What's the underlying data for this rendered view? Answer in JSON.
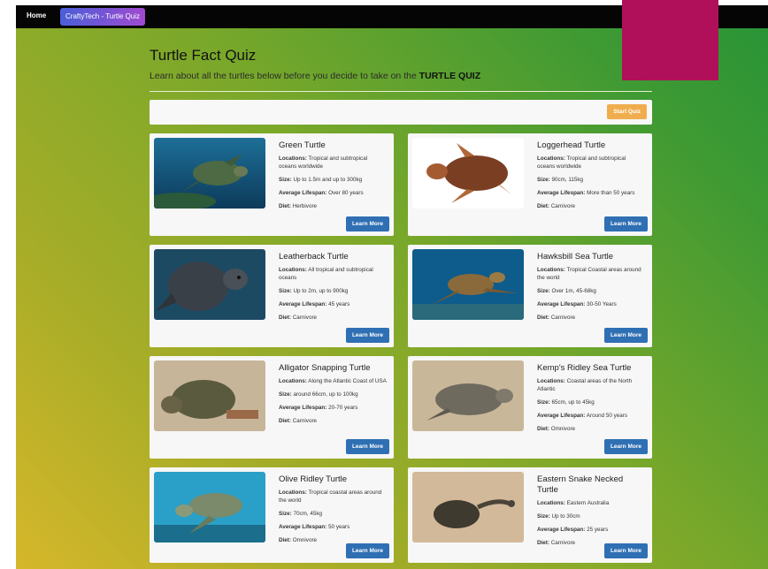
{
  "nav": {
    "home": "Home",
    "brand": "CraftyTech - Turtle Quiz"
  },
  "colors": {
    "accent_box": "#b0105a",
    "start_button": "#f0ad4e",
    "learn_button": "#2f6fb3"
  },
  "header": {
    "title": "Turtle Fact Quiz",
    "subtitle_prefix": "Learn about all the turtles below before you decide to take on the ",
    "subtitle_strong": "TURTLE QUIZ"
  },
  "toolbar": {
    "start_label": "Start Quiz"
  },
  "labels": {
    "locations": "Locations:",
    "size": "Size:",
    "lifespan": "Average Lifespan:",
    "diet": "Diet:",
    "learn_more": "Learn More"
  },
  "turtles": [
    {
      "name": "Green Turtle",
      "locations": "Tropical and subtropical oceans worldwide",
      "size": "Up to 1.5m and up to 300kg",
      "lifespan": "Over 80 years",
      "diet": "Herbivore"
    },
    {
      "name": "Loggerhead Turtle",
      "locations": "Tropical and subtropical oceans worldwide",
      "size": "90cm, 115kg",
      "lifespan": "More than 50 years",
      "diet": "Carnivore"
    },
    {
      "name": "Leatherback Turtle",
      "locations": "All tropical and subtropical oceans",
      "size": "Up to 2m, up to 900kg",
      "lifespan": "45 years",
      "diet": "Carnivore"
    },
    {
      "name": "Hawksbill Sea Turtle",
      "locations": "Tropical Coastal areas around the world",
      "size": "Over 1m, 45-68kg",
      "lifespan": "30-50 Years",
      "diet": "Carnivore"
    },
    {
      "name": "Alligator Snapping Turtle",
      "locations": "Along the Atlantic Coast of USA",
      "size": "around 66cm, up to 100kg",
      "lifespan": "20-70 years",
      "diet": "Carnivore"
    },
    {
      "name": "Kemp's Ridley Sea Turtle",
      "locations": "Coastal areas of the North Atlantic",
      "size": "65cm, up to 45kg",
      "lifespan": "Around 50 years",
      "diet": "Omnivore"
    },
    {
      "name": "Olive Ridley Turtle",
      "locations": "Tropical coastal areas around the world",
      "size": "70cm, 45kg",
      "lifespan": "50 years",
      "diet": "Omnivore"
    },
    {
      "name": "Eastern Snake Necked Turtle",
      "locations": "Eastern Australia",
      "size": "Up to 30cm",
      "lifespan": "25 years",
      "diet": "Carnivore"
    }
  ]
}
